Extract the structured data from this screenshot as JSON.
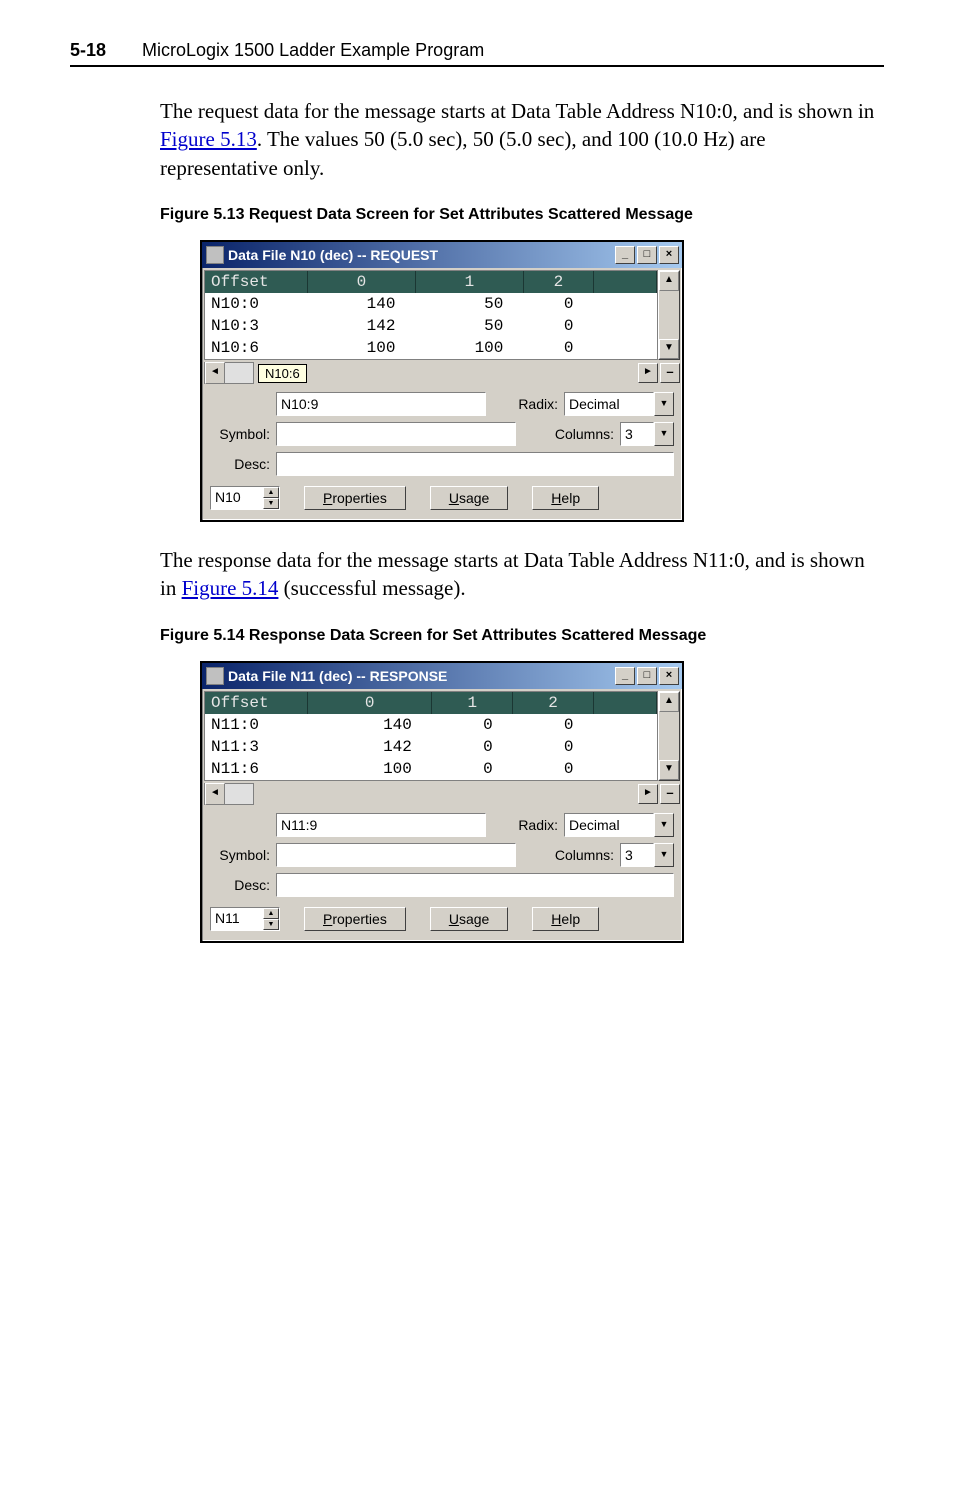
{
  "header": {
    "page_number": "5-18",
    "title": "MicroLogix 1500 Ladder Example Program"
  },
  "paragraph1": {
    "pre": "The request data for the message starts at Data Table Address N10:0, and is shown in ",
    "link": "Figure 5.13",
    "post": ". The values 50 (5.0 sec), 50 (5.0 sec), and 100 (10.0 Hz) are representative only."
  },
  "figure1": {
    "caption": "Figure 5.13   Request Data Screen for Set Attributes Scattered Message"
  },
  "dialog1": {
    "title": "Data File N10 (dec)  --  REQUEST",
    "columns": [
      "Offset",
      "0",
      "1",
      "2"
    ],
    "rows": [
      {
        "offset": "N10:0",
        "cells": [
          "140",
          "50",
          "0"
        ]
      },
      {
        "offset": "N10:3",
        "cells": [
          "142",
          "50",
          "0"
        ]
      },
      {
        "offset": "N10:6",
        "cells": [
          "100",
          "100",
          "0"
        ]
      }
    ],
    "tooltip": "N10:6",
    "address_value": "N10:9",
    "radix_label": "Radix:",
    "radix_value": "Decimal",
    "symbol_label": "Symbol:",
    "columns_label": "Columns:",
    "columns_value": "3",
    "desc_label": "Desc:",
    "file_spinner": "N10",
    "btn_properties": "Properties",
    "btn_usage": "Usage",
    "btn_help": "Help"
  },
  "paragraph2": {
    "pre": "The response data for the message starts at Data Table Address N11:0, and is shown in ",
    "link": "Figure 5.14",
    "post": " (successful message)."
  },
  "figure2": {
    "caption": "Figure 5.14   Response Data Screen for Set Attributes Scattered Message"
  },
  "dialog2": {
    "title": "Data File N11 (dec)  --  RESPONSE",
    "columns": [
      "Offset",
      "0",
      "1",
      "2"
    ],
    "rows": [
      {
        "offset": "N11:0",
        "cells": [
          "140",
          "0",
          "0"
        ]
      },
      {
        "offset": "N11:3",
        "cells": [
          "142",
          "0",
          "0"
        ]
      },
      {
        "offset": "N11:6",
        "cells": [
          "100",
          "0",
          "0"
        ]
      }
    ],
    "address_value": "N11:9",
    "radix_label": "Radix:",
    "radix_value": "Decimal",
    "symbol_label": "Symbol:",
    "columns_label": "Columns:",
    "columns_value": "3",
    "desc_label": "Desc:",
    "file_spinner": "N11",
    "btn_properties": "Properties",
    "btn_usage": "Usage",
    "btn_help": "Help"
  }
}
